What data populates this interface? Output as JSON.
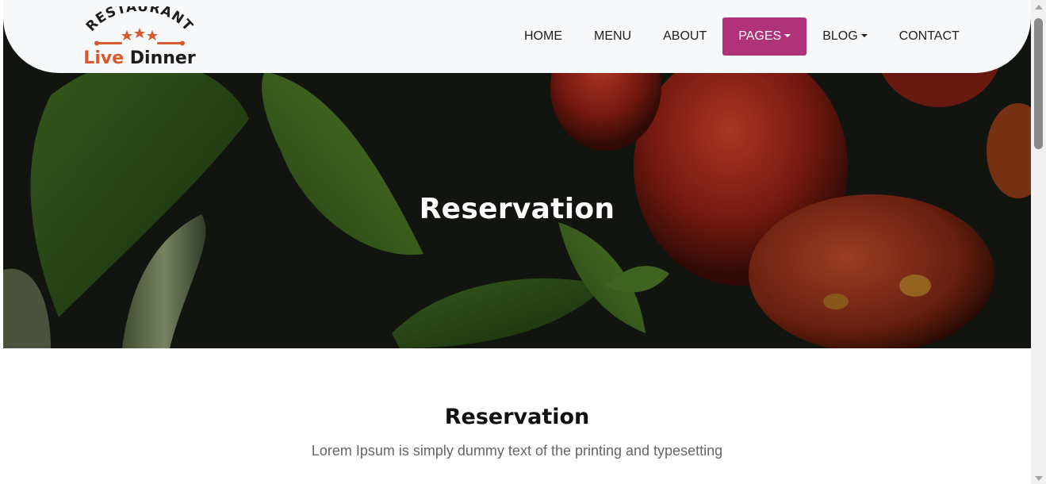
{
  "logo": {
    "arc_text": "RESTAURANT",
    "word_live": "Live",
    "word_dinner": "Dinner",
    "accent_color": "#d85a2a"
  },
  "nav": {
    "items": [
      {
        "label": "HOME",
        "dropdown": false,
        "active": false
      },
      {
        "label": "MENU",
        "dropdown": false,
        "active": false
      },
      {
        "label": "ABOUT",
        "dropdown": false,
        "active": false
      },
      {
        "label": "PAGES",
        "dropdown": true,
        "active": true
      },
      {
        "label": "BLOG",
        "dropdown": true,
        "active": false
      },
      {
        "label": "CONTACT",
        "dropdown": false,
        "active": false
      }
    ],
    "active_color": "#b03379"
  },
  "hero": {
    "title": "Reservation"
  },
  "section": {
    "title": "Reservation",
    "subtitle": "Lorem Ipsum is simply dummy text of the printing and typesetting"
  }
}
